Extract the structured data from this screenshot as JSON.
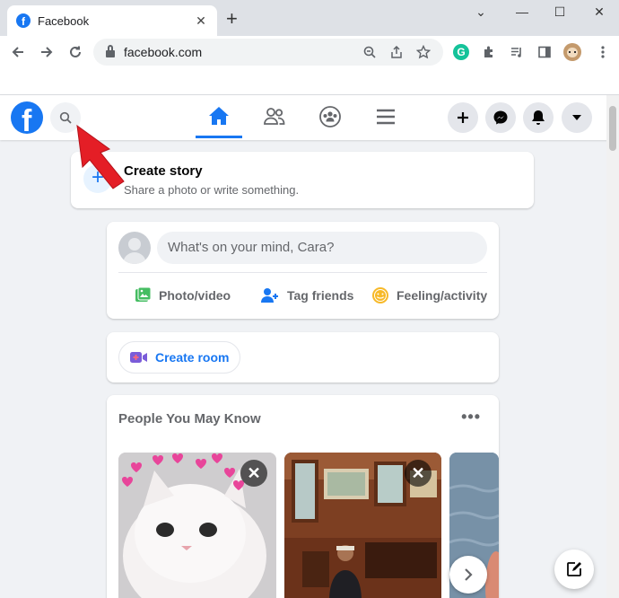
{
  "browser": {
    "tab_title": "Facebook",
    "tab_favicon_letter": "f",
    "url": "facebook.com",
    "new_tab_glyph": "+",
    "extension_g_letter": "G"
  },
  "facebook": {
    "logo_letter": "f",
    "story": {
      "title": "Create story",
      "subtitle": "Share a photo or write something."
    },
    "composer": {
      "placeholder": "What's on your mind, Cara?",
      "actions": [
        "Photo/video",
        "Tag friends",
        "Feeling/activity"
      ]
    },
    "room": {
      "label": "Create room"
    },
    "pymk": {
      "title": "People You May Know"
    }
  },
  "colors": {
    "brand": "#1877f2",
    "photo_video": "#45bd62",
    "tag_friends": "#1877f2",
    "feeling": "#f7b928",
    "room": "#7a5cd9",
    "annotation_arrow": "#e41e26"
  },
  "icons": [
    "search-icon",
    "home-icon",
    "friends-icon",
    "groups-icon",
    "menu-icon",
    "plus-icon",
    "messenger-icon",
    "notifications-icon",
    "caret-down-icon",
    "compose-icon"
  ]
}
